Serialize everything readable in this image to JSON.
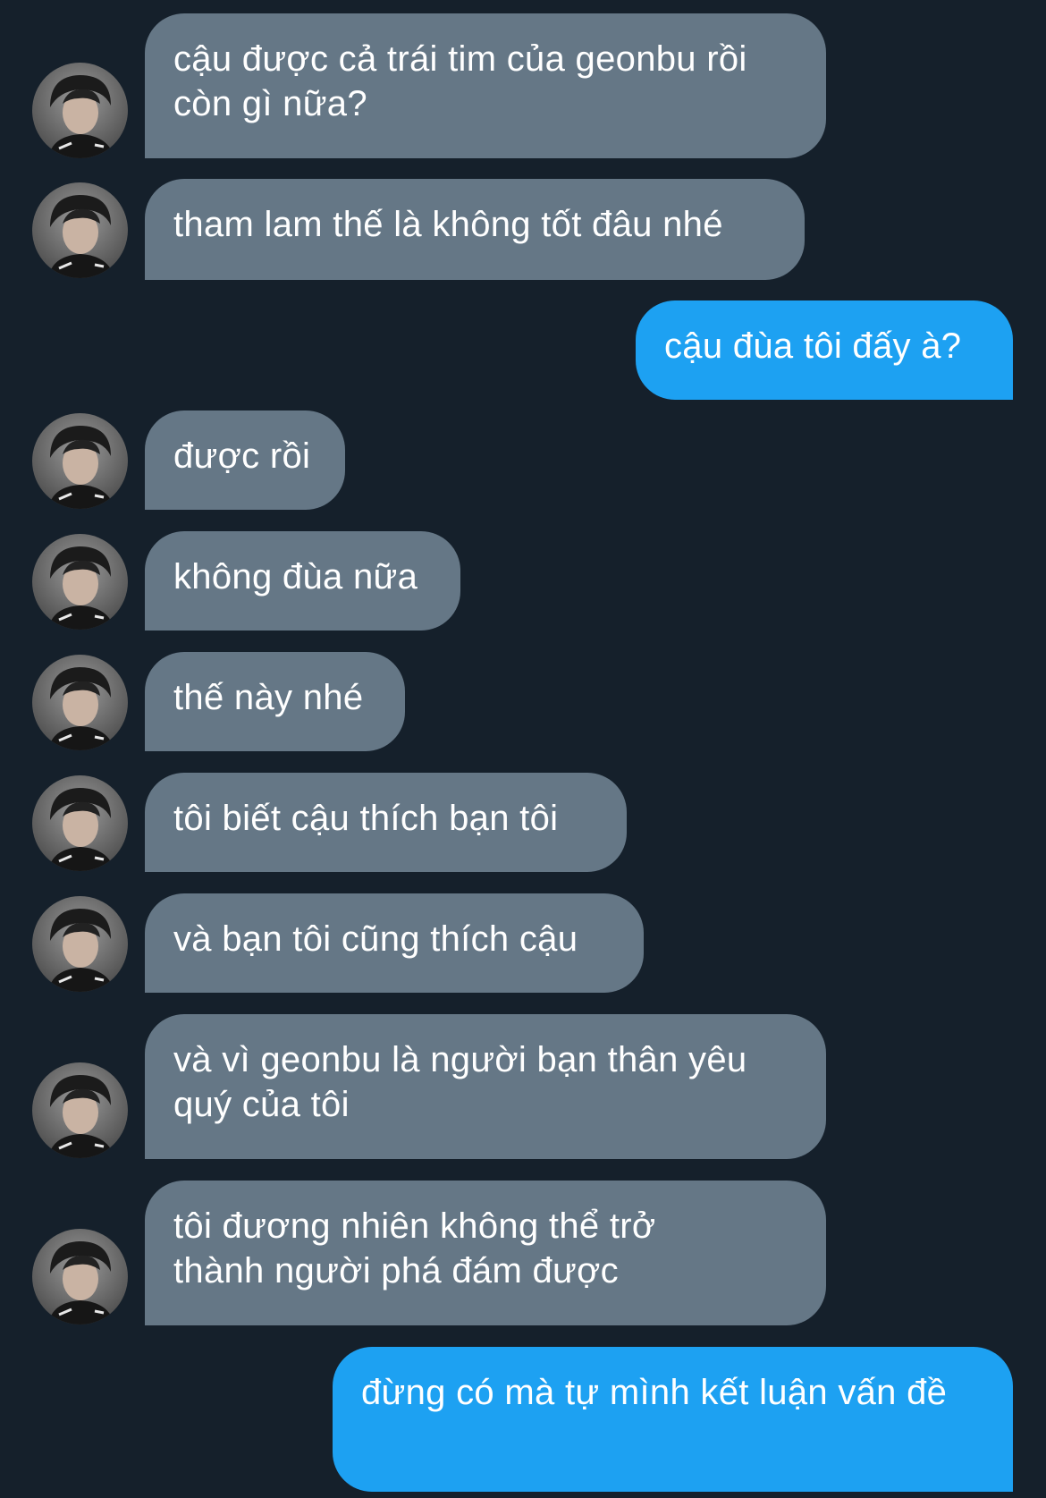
{
  "conversation": {
    "messages": [
      {
        "sender": "other",
        "text": "cậu được cả trái tim của geonbu rồi còn gì nữa?",
        "avatar": "avatar-portrait"
      },
      {
        "sender": "other",
        "text": "tham lam thế là không tốt đâu nhé",
        "avatar": "avatar-portrait"
      },
      {
        "sender": "me",
        "text": "cậu đùa tôi đấy à?"
      },
      {
        "sender": "other",
        "text": "được rồi",
        "avatar": "avatar-portrait"
      },
      {
        "sender": "other",
        "text": "không đùa nữa",
        "avatar": "avatar-portrait"
      },
      {
        "sender": "other",
        "text": "thế này nhé",
        "avatar": "avatar-portrait"
      },
      {
        "sender": "other",
        "text": "tôi biết cậu thích bạn tôi",
        "avatar": "avatar-portrait"
      },
      {
        "sender": "other",
        "text": "và bạn tôi cũng thích cậu",
        "avatar": "avatar-portrait"
      },
      {
        "sender": "other",
        "text": "và vì geonbu là người bạn thân yêu quý của tôi",
        "avatar": "avatar-portrait"
      },
      {
        "sender": "other",
        "text": "tôi đương nhiên không thể trở thành người phá đám được",
        "avatar": "avatar-portrait"
      },
      {
        "sender": "me",
        "text": "đừng có mà tự mình kết luận vấn đề"
      }
    ]
  },
  "colors": {
    "background": "#15202b",
    "incoming_bubble": "#657786",
    "outgoing_bubble": "#1da1f2",
    "text": "#ffffff"
  }
}
